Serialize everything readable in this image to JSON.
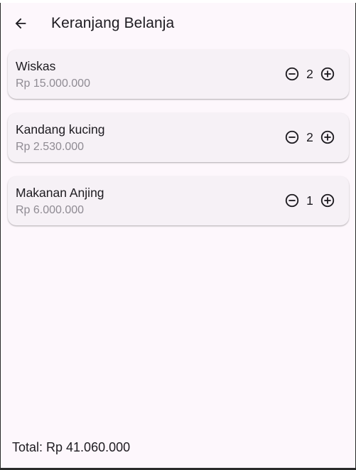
{
  "app_bar": {
    "back_icon": "arrow-back-icon",
    "title": "Keranjang Belanja"
  },
  "cart": {
    "items": [
      {
        "name": "Wiskas",
        "price": "Rp 15.000.000",
        "quantity": "2"
      },
      {
        "name": "Kandang kucing",
        "price": "Rp 2.530.000",
        "quantity": "2"
      },
      {
        "name": "Makanan Anjing",
        "price": "Rp 6.000.000",
        "quantity": "1"
      }
    ],
    "decrement_icon": "remove-circle-outline-icon",
    "increment_icon": "add-circle-outline-icon"
  },
  "footer": {
    "total": "Total: Rp 41.060.000"
  },
  "colors": {
    "background": "#fdf7fc",
    "card": "#f6f1f6",
    "text": "#1d1b20",
    "secondary_text": "#8f8b93"
  }
}
